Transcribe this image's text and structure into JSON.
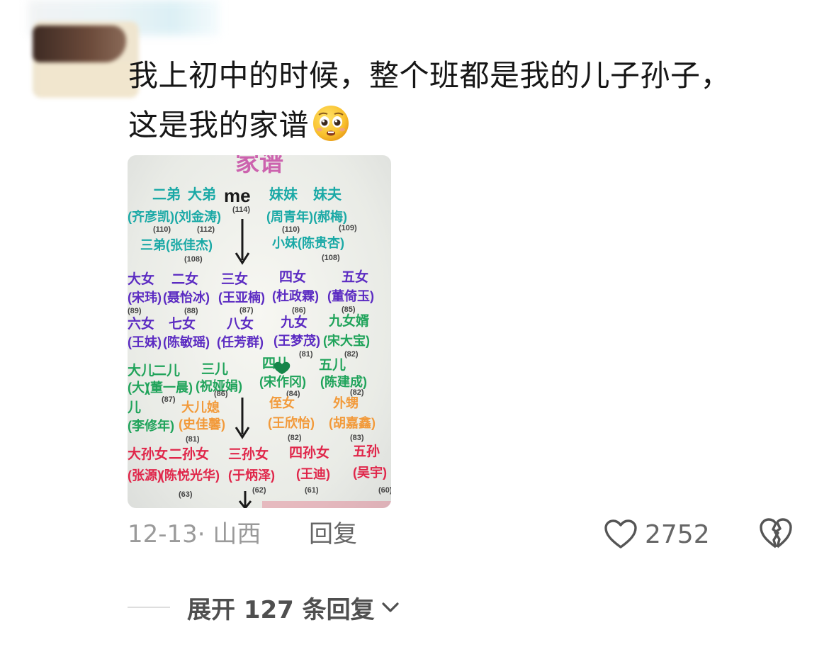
{
  "comment": {
    "text_line1": "我上初中的时候，整个班都是我的儿子孙子，",
    "text_line2": "这是我的家谱",
    "emoji": "pleading-face-emoji"
  },
  "photo": {
    "title": "家谱",
    "row1_labels": [
      "二弟",
      "大弟",
      "me",
      "妹妹",
      "妹夫"
    ],
    "row1_me_num": "(114)",
    "row2_labels": [
      "(齐彦凯)",
      "(刘金涛)",
      "(周青年)",
      "(郝梅)"
    ],
    "row2_nums": [
      "(110)",
      "(112)",
      "(110)",
      "(109)"
    ],
    "row3_labels": [
      "三弟(张佳杰)",
      "小妹(陈贵杏)"
    ],
    "row3_nums": [
      "(108)",
      "(108)"
    ],
    "daughters_titles": [
      "大女",
      "二女",
      "三女",
      "四女",
      "五女"
    ],
    "daughters_names": [
      "(宋玮)",
      "(聂怡冰)",
      "(王亚楠)",
      "(杜政霖)",
      "(董倚玉)"
    ],
    "daughters_nums": [
      "(89)",
      "(88)",
      "(87)",
      "(86)",
      "(85)"
    ],
    "daughters2_titles": [
      "六女",
      "七女",
      "八女",
      "九女",
      "九女婿"
    ],
    "daughters2_names": [
      "(王妹)",
      "(陈敏瑶)",
      "(任芳群)",
      "(王梦茂)",
      "(宋大宝)"
    ],
    "daughters2_nums": [
      "(81)",
      "(82)"
    ],
    "sons_titles": [
      "大儿",
      "二儿",
      "三儿",
      "四儿",
      "五儿"
    ],
    "sons_names": [
      "(大)",
      "(董一晨)",
      "(祝娅娟)",
      "(宋作冈)",
      "(陈建成)"
    ],
    "sons_nums": [
      "(87)",
      "(86)",
      "(84)",
      "(82)"
    ],
    "inlaws_titles": [
      "儿",
      "大儿媳",
      "侄女",
      "外甥"
    ],
    "inlaws_names": [
      "(李修年)",
      "(史佳馨)",
      "(王欣怡)",
      "(胡嘉鑫)"
    ],
    "inlaws_nums": [
      "(81)",
      "(82)",
      "(83)"
    ],
    "grand_titles": [
      "大孙女",
      "二孙女",
      "三孙女",
      "四孙女",
      "五孙"
    ],
    "grand_names": [
      "(张源)",
      "(陈悦光华)",
      "(于炳泽)",
      "(王迪)",
      "(吴宇)"
    ],
    "grand_nums": [
      "(63)",
      "(62)",
      "(61)",
      "(60)"
    ]
  },
  "meta": {
    "date_location": "12-13· 山西",
    "reply_label": "回复",
    "like_count": "2752"
  },
  "expand": {
    "label": "展开 127 条回复"
  },
  "colors": {
    "teal": "#1aa9a6",
    "purple": "#5b2bc2",
    "green": "#1fa35a",
    "orange": "#f29a3a",
    "red": "#e0264a",
    "magenta": "#c2359b"
  }
}
